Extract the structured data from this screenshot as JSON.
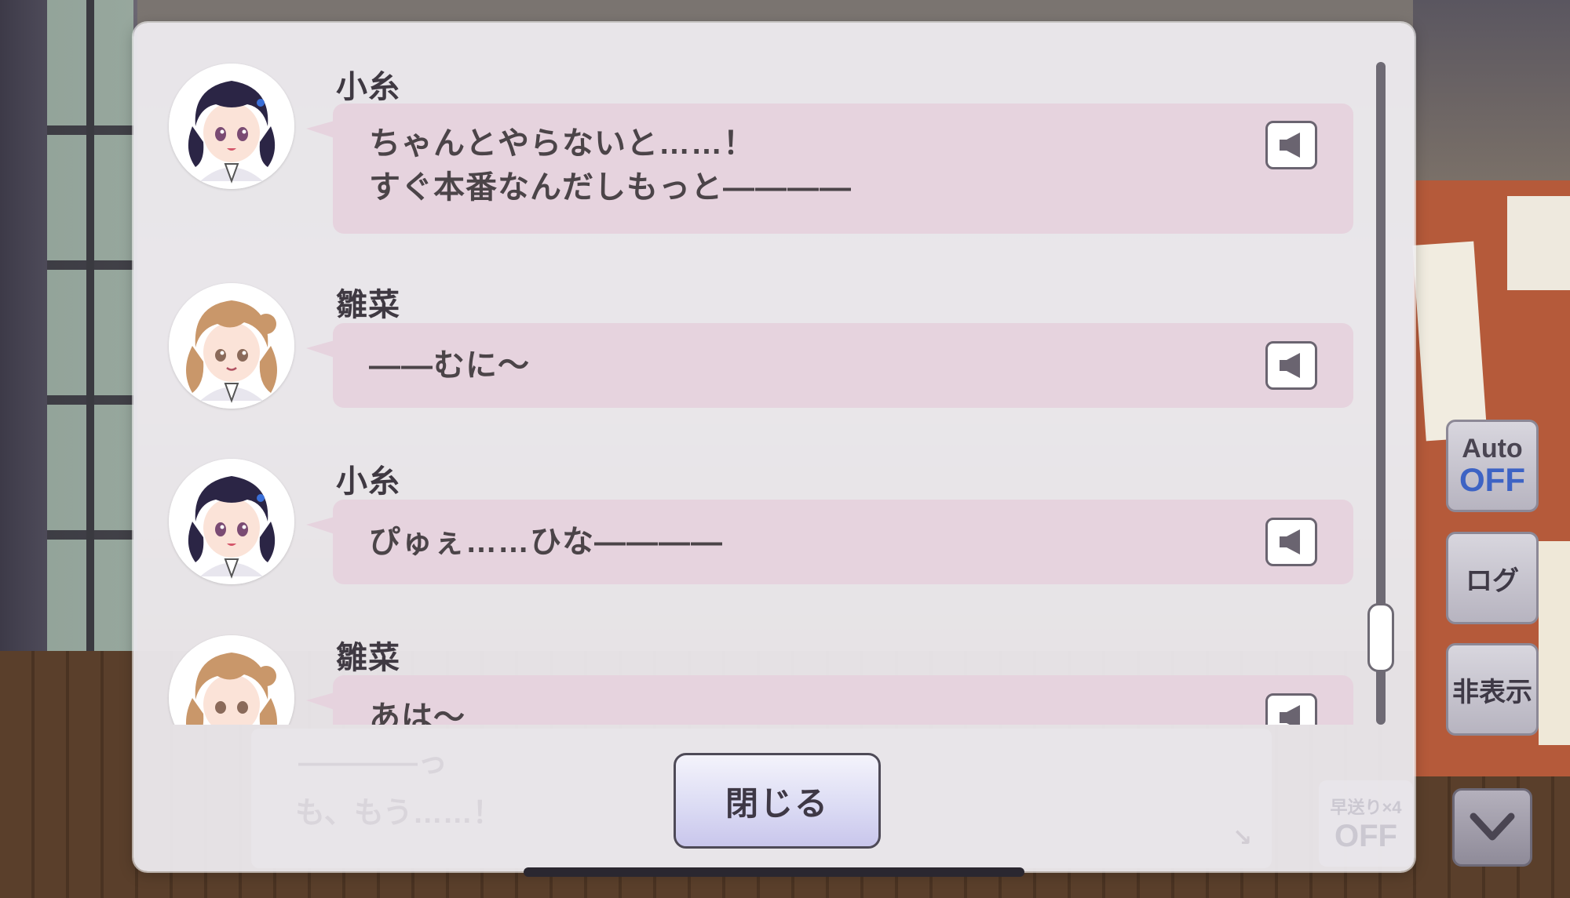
{
  "log": {
    "entries": [
      {
        "speaker": "小糸",
        "text": "ちゃんとやらないと……！\nすぐ本番なんだしもっと――――",
        "avatar": "koito-avatar",
        "voice_icon": "speaker-icon"
      },
      {
        "speaker": "雛菜",
        "text": "――むに～",
        "avatar": "hinana-avatar",
        "voice_icon": "speaker-icon"
      },
      {
        "speaker": "小糸",
        "text": "ぴゅぇ……ひな――――",
        "avatar": "koito-avatar",
        "voice_icon": "speaker-icon"
      },
      {
        "speaker": "雛菜",
        "text": "あは～",
        "avatar": "hinana-avatar",
        "voice_icon": "speaker-icon"
      }
    ]
  },
  "underlying_message": {
    "line1": "――――っ",
    "line2": "も、もう……！"
  },
  "close_label": "閉じる",
  "controls": {
    "auto_top": "Auto",
    "auto_bottom": "OFF",
    "log_label": "ログ",
    "hide_label": "非表示",
    "fast_forward_top": "早送り×4",
    "fast_forward_bottom": "OFF"
  },
  "colors": {
    "bubble": "#e6d3de",
    "auto_off": "#3d63c4",
    "panel": "#f0eef2"
  }
}
